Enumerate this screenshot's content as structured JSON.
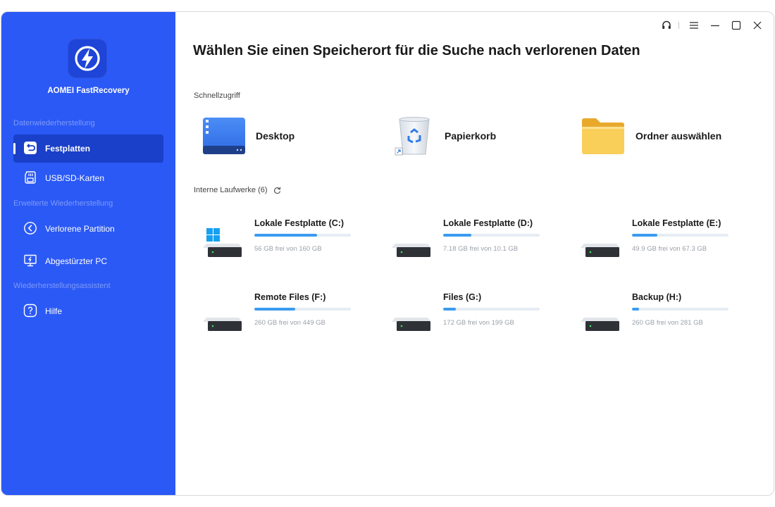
{
  "app": {
    "name": "AOMEI FastRecovery"
  },
  "sidebar": {
    "sections": [
      {
        "label": "Datenwiederherstellung"
      },
      {
        "label": "Erweiterte Wiederherstellung"
      },
      {
        "label": "Wiederherstellungsassistent"
      }
    ],
    "items": [
      {
        "label": "Festplatten",
        "icon": "disk-recovery-icon",
        "active": true
      },
      {
        "label": "USB/SD-Karten",
        "icon": "sd-card-icon",
        "active": false
      },
      {
        "label": "Verlorene Partition",
        "icon": "partition-icon",
        "active": false
      },
      {
        "label": "Abgestürzter PC",
        "icon": "crashed-pc-icon",
        "active": false
      },
      {
        "label": "Hilfe",
        "icon": "help-icon",
        "active": false
      }
    ]
  },
  "titlebar": {
    "icons": [
      "headset-icon",
      "menu-icon",
      "minimize-icon",
      "maximize-icon",
      "close-icon"
    ]
  },
  "main": {
    "title": "Wählen Sie einen Speicherort für die Suche nach verlorenen Daten",
    "quick_access": {
      "label": "Schnellzugriff",
      "items": [
        {
          "label": "Desktop",
          "icon": "desktop-icon"
        },
        {
          "label": "Papierkorb",
          "icon": "recycle-bin-icon"
        },
        {
          "label": "Ordner auswählen",
          "icon": "folder-icon"
        }
      ]
    },
    "drives": {
      "label": "Interne Laufwerke (6)",
      "refresh_icon": "refresh-icon",
      "items": [
        {
          "name": "Lokale Festplatte (C:)",
          "free": "56 GB frei von 160 GB",
          "used_fraction": 0.65,
          "system": true
        },
        {
          "name": "Lokale Festplatte (D:)",
          "free": "7.18 GB frei von 10.1 GB",
          "used_fraction": 0.29,
          "system": false
        },
        {
          "name": "Lokale Festplatte (E:)",
          "free": "49.9 GB frei von 67.3 GB",
          "used_fraction": 0.26,
          "system": false
        },
        {
          "name": "Remote Files (F:)",
          "free": "260 GB frei von 449 GB",
          "used_fraction": 0.42,
          "system": false
        },
        {
          "name": "Files (G:)",
          "free": "172 GB frei von 199 GB",
          "used_fraction": 0.13,
          "system": false
        },
        {
          "name": "Backup (H:)",
          "free": "260 GB frei von 281 GB",
          "used_fraction": 0.07,
          "system": false
        }
      ]
    }
  },
  "colors": {
    "sidebar": "#2b59f5",
    "sidebar_active": "#1a3fc9",
    "progress": "#3a9bf0",
    "progress_track": "#e6ecf3",
    "folder": "#f7c64b"
  }
}
